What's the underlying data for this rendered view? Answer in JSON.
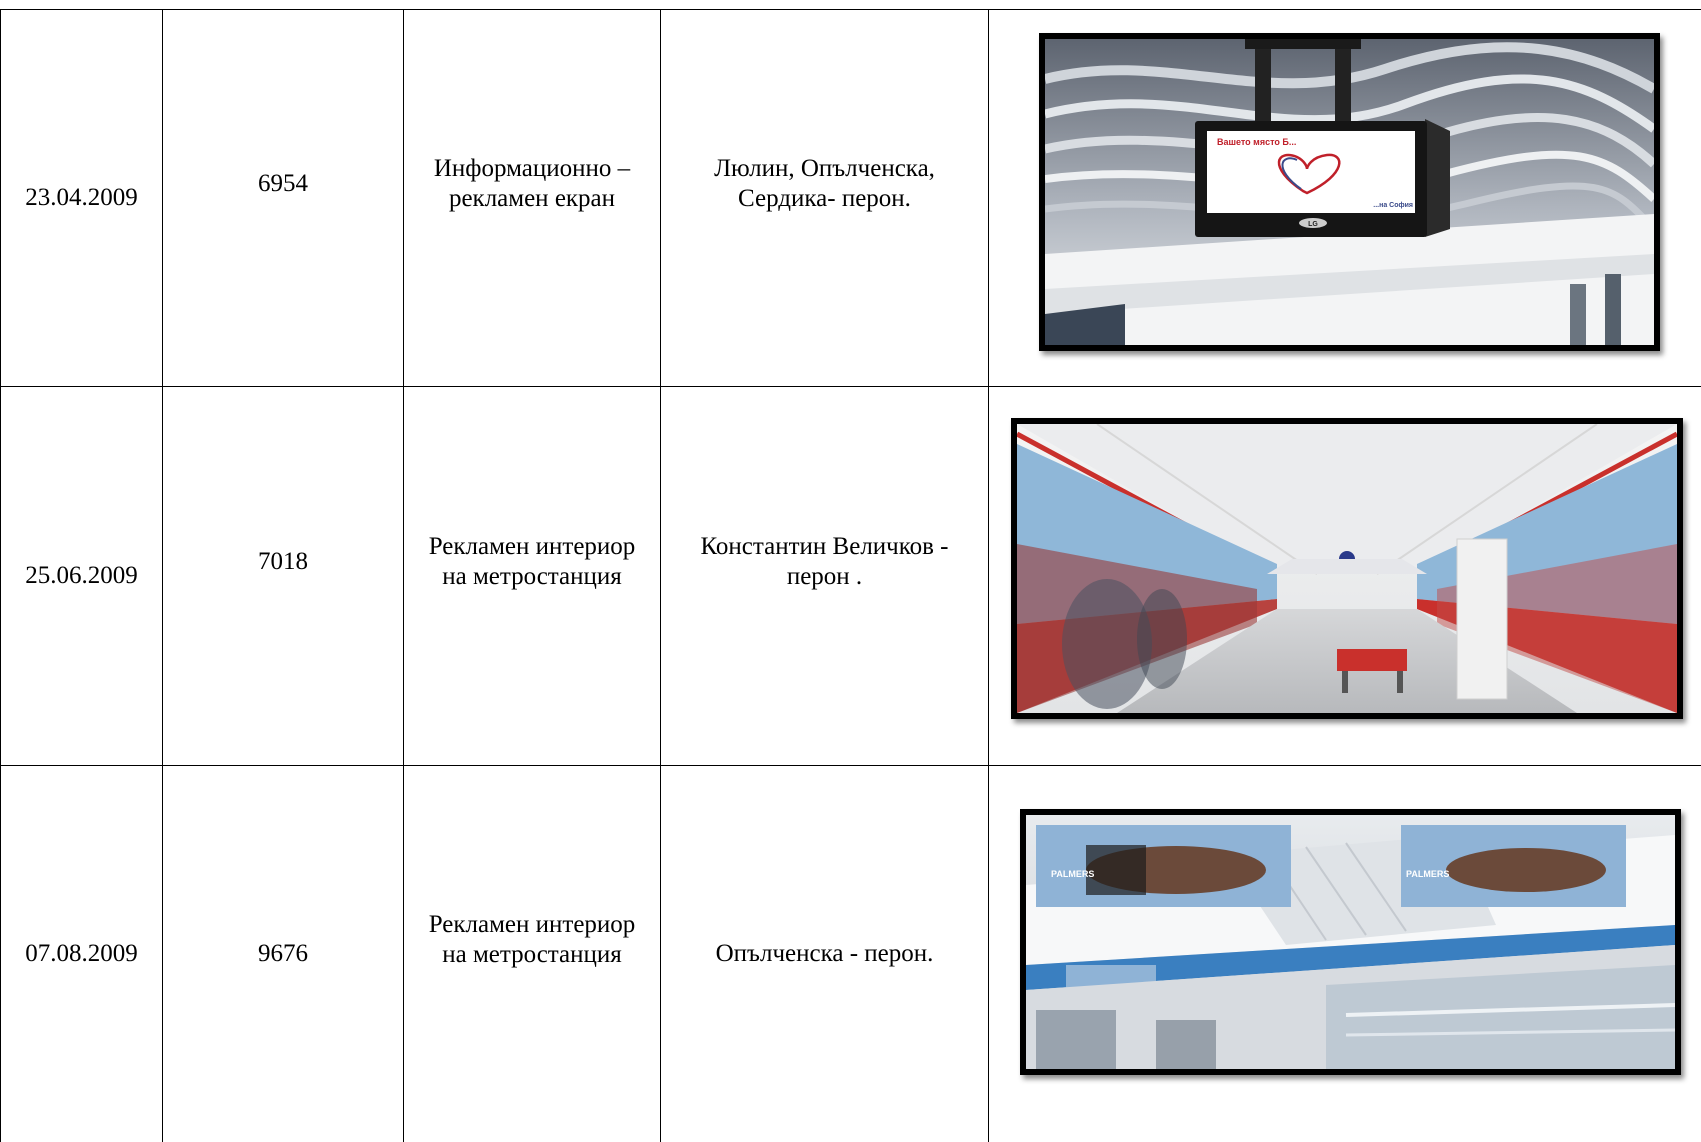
{
  "rows": [
    {
      "date": "23.04.2009",
      "number": "6954",
      "description": "Информационно – рекламен екран",
      "location": "Люлин, Опълченска, Сердика- перон.",
      "photo": {
        "screen_text_top": "Вашето място Б...",
        "screen_text_bottom": "...на София",
        "brand": "LG",
        "heart_color": "#c0202a",
        "heart_color_2": "#3a4a8a"
      }
    },
    {
      "date": "25.06.2009",
      "number": "7018",
      "description": "Рекламен интериор на метростанция",
      "location": "Константин Величков - перон .",
      "photo": {
        "accent": "#c9302c"
      }
    },
    {
      "date": "07.08.2009",
      "number": "9676",
      "description": "Рекламен интериор на метростанция",
      "location": "Опълченска - перон.",
      "photo": {
        "brand": "PALMERS",
        "accent": "#3a7fc0"
      }
    }
  ]
}
